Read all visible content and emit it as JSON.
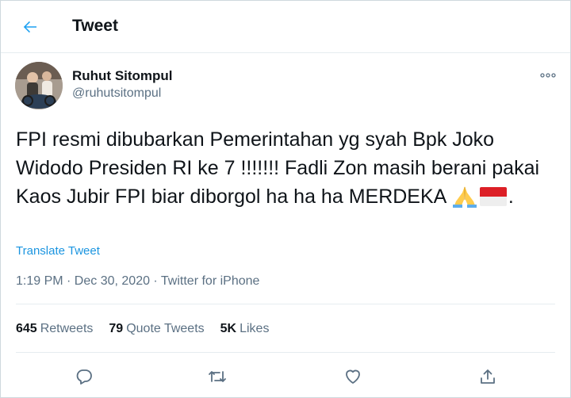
{
  "header": {
    "title": "Tweet",
    "back_icon": "arrow-left-icon"
  },
  "author": {
    "name": "Ruhut Sitompul",
    "handle": "@ruhutsitompul"
  },
  "tweet": {
    "text": "FPI resmi dibubarkan Pemerintahan yg syah Bpk Joko Widodo Presiden RI ke 7 !!!!!!! Fadli Zon masih berani pakai Kaos Jubir FPI biar diborgol ha ha ha MERDEKA",
    "emojis": [
      "folded-hands-emoji",
      "indonesia-flag-emoji"
    ],
    "trailing": ".",
    "translate_label": "Translate Tweet",
    "meta": "1:19 PM · Dec 30, 2020 · Twitter for iPhone"
  },
  "stats": {
    "retweets_count": "645",
    "retweets_label": "Retweets",
    "quotes_count": "79",
    "quotes_label": "Quote Tweets",
    "likes_count": "5K",
    "likes_label": "Likes"
  },
  "colors": {
    "accent": "#1da1f2",
    "link": "#1b95e0",
    "muted": "#5b7083",
    "text": "#0f1419"
  }
}
